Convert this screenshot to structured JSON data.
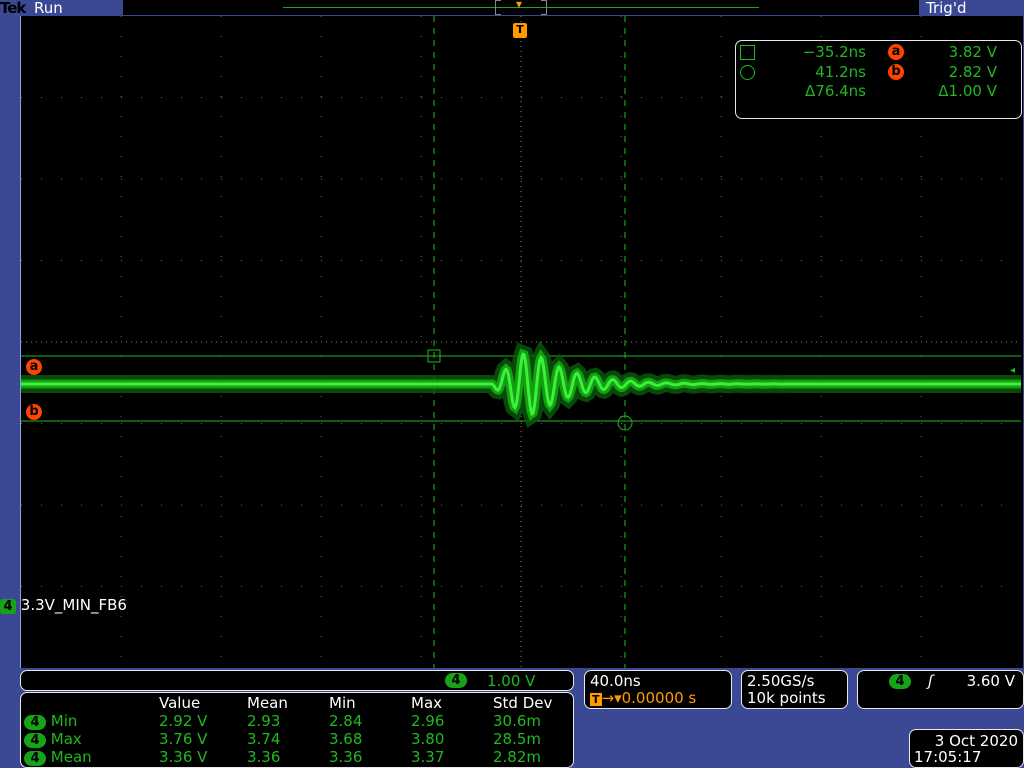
{
  "header": {
    "brand": "Tek",
    "state": "Run",
    "trigger_status": "Trig'd"
  },
  "cursor_readout": {
    "c1_time": "−35.2ns",
    "c2_time": "41.2ns",
    "delta_time": "Δ76.4ns",
    "a_label": "a",
    "b_label": "b",
    "a_volt": "3.82 V",
    "b_volt": "2.82 V",
    "delta_volt": "Δ1.00 V"
  },
  "channel": {
    "number": "4",
    "label": "3.3V_MIN_FB6",
    "scale": "1.00 V",
    "color": "#1fb81f"
  },
  "markers": {
    "trigger": "T",
    "a": "a",
    "b": "b"
  },
  "measurements": {
    "headers": [
      "Value",
      "Mean",
      "Min",
      "Max",
      "Std Dev"
    ],
    "rows": [
      {
        "ch": "4",
        "name": "Min",
        "value": "2.92 V",
        "mean": "2.93",
        "min": "2.84",
        "max": "2.96",
        "std": "30.6m"
      },
      {
        "ch": "4",
        "name": "Max",
        "value": "3.76 V",
        "mean": "3.74",
        "min": "3.68",
        "max": "3.80",
        "std": "28.5m"
      },
      {
        "ch": "4",
        "name": "Mean",
        "value": "3.36 V",
        "mean": "3.36",
        "min": "3.36",
        "max": "3.37",
        "std": "2.82m"
      }
    ]
  },
  "timebase": {
    "scale": "40.0ns",
    "position": "0.00000 s"
  },
  "acquisition": {
    "rate": "2.50GS/s",
    "points": "10k points"
  },
  "trigger": {
    "channel": "4",
    "slope": "rising",
    "level": "3.60 V"
  },
  "datetime": {
    "date": "3 Oct  2020",
    "time": "17:05:17"
  }
}
